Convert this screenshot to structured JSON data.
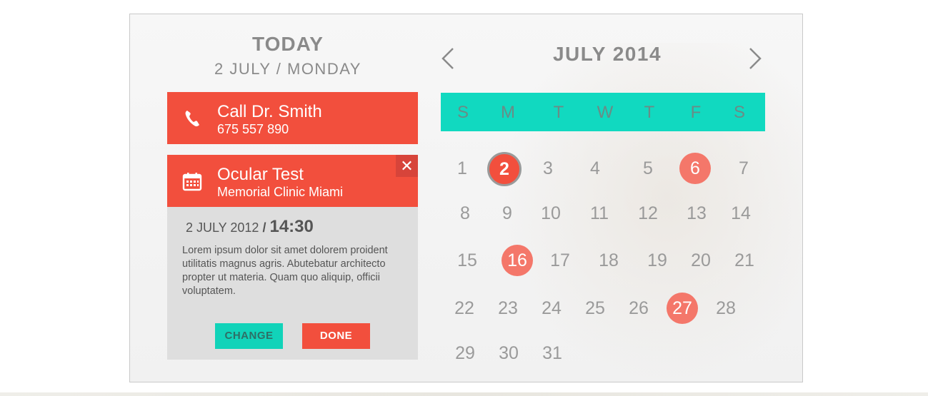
{
  "today": {
    "heading": "TODAY",
    "date": "2 JULY / MONDAY"
  },
  "events": [
    {
      "title": "Call Dr. Smith",
      "subtitle": "675 557 890",
      "icon": "phone-icon"
    },
    {
      "title": "Ocular Test",
      "subtitle": "Memorial Clinic Miami",
      "icon": "calendar-icon",
      "close_label": "✕"
    }
  ],
  "detail": {
    "date": "2 JULY 2012",
    "separator": "/",
    "time": "14:30",
    "description": "Lorem ipsum dolor sit amet dolorem proident utilitatis magnus agris. Abutebatur architecto propter ut materia. Quam quo aliquip, officii voluptatem.",
    "change_label": "CHANGE",
    "done_label": "DONE"
  },
  "calendar": {
    "month_title": "JULY 2014",
    "weekdays": [
      "S",
      "M",
      "T",
      "W",
      "T",
      "F",
      "S"
    ],
    "weeks": [
      [
        "1",
        "2",
        "3",
        "4",
        "5",
        "6",
        "7"
      ],
      [
        "8",
        "9",
        "10",
        "11",
        "12",
        "13",
        "14"
      ],
      [
        "15",
        "16",
        "17",
        "18",
        "19",
        "20",
        "21"
      ],
      [
        "22",
        "23",
        "24",
        "25",
        "26",
        "27",
        "28"
      ],
      [
        "29",
        "30",
        "31"
      ]
    ],
    "selected_day": "2",
    "marked_days": [
      "6",
      "16",
      "27"
    ]
  },
  "colors": {
    "accent_red": "#f24f3d",
    "marked_red": "#f4776a",
    "teal": "#11d9c0",
    "text_gray": "#8a8a8a"
  }
}
